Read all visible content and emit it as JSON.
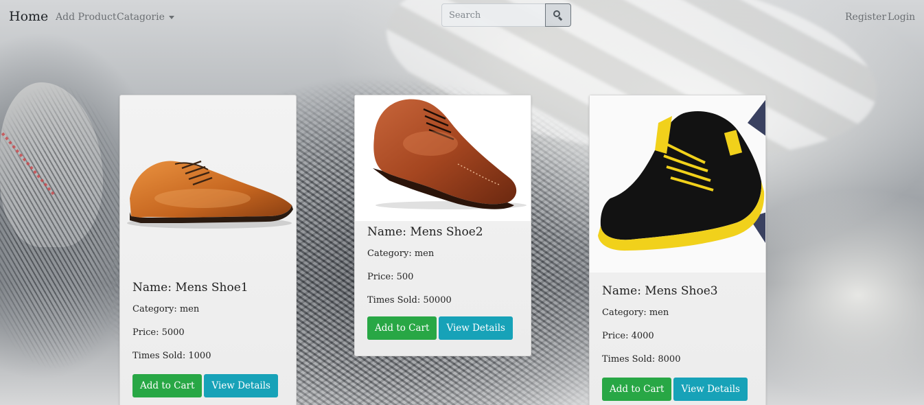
{
  "navbar": {
    "brand": "Home",
    "links": [
      "Add Product",
      "Catagorie"
    ],
    "search_placeholder": "Search",
    "right_links": [
      "Register",
      "Login"
    ]
  },
  "products": [
    {
      "name": "Name: Mens Shoe1",
      "category": "Category: men",
      "price": "Price: 5000",
      "times_sold": "Times Sold: 1000",
      "image": "tan-leather-oxford-shoe"
    },
    {
      "name": "Name: Mens Shoe2",
      "category": "Category: men",
      "price": "Price: 500",
      "times_sold": "Times Sold: 50000",
      "image": "brown-brogue-shoe"
    },
    {
      "name": "Name: Mens Shoe3",
      "category": "Category: men",
      "price": "Price: 4000",
      "times_sold": "Times Sold: 8000",
      "image": "black-yellow-sneaker"
    }
  ],
  "buttons": {
    "add_to_cart": "Add to Cart",
    "view_details": "View Details"
  },
  "colors": {
    "add_to_cart": "#28a745",
    "view_details": "#17a2b8"
  }
}
